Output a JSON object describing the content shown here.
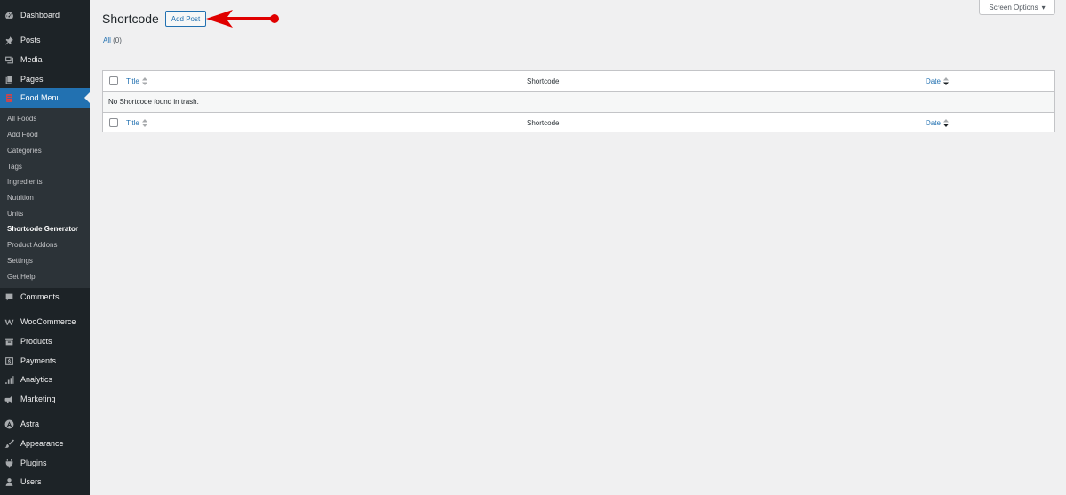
{
  "sidebar": {
    "items": [
      {
        "label": "Dashboard",
        "icon": "dashboard-icon"
      },
      {
        "label": "Posts",
        "icon": "pin-icon"
      },
      {
        "label": "Media",
        "icon": "media-icon"
      },
      {
        "label": "Pages",
        "icon": "pages-icon"
      },
      {
        "label": "Food Menu",
        "icon": "food-menu-icon"
      },
      {
        "label": "Comments",
        "icon": "comment-icon"
      },
      {
        "label": "WooCommerce",
        "icon": "woocommerce-icon"
      },
      {
        "label": "Products",
        "icon": "archive-icon"
      },
      {
        "label": "Payments",
        "icon": "dollar-icon"
      },
      {
        "label": "Analytics",
        "icon": "bar-chart-icon"
      },
      {
        "label": "Marketing",
        "icon": "megaphone-icon"
      },
      {
        "label": "Astra",
        "icon": "astra-icon"
      },
      {
        "label": "Appearance",
        "icon": "brush-icon"
      },
      {
        "label": "Plugins",
        "icon": "plugin-icon"
      },
      {
        "label": "Users",
        "icon": "user-icon"
      }
    ],
    "submenu": [
      "All Foods",
      "Add Food",
      "Categories",
      "Tags",
      "Ingredients",
      "Nutrition",
      "Units",
      "Shortcode Generator",
      "Product Addons",
      "Settings",
      "Get Help"
    ]
  },
  "header": {
    "title": "Shortcode",
    "add_button": "Add Post",
    "screen_options": "Screen Options"
  },
  "filters": {
    "all_label": "All",
    "all_count": "(0)"
  },
  "table": {
    "columns": [
      "Title",
      "Shortcode",
      "Date"
    ],
    "empty_message": "No Shortcode found in trash."
  },
  "colors": {
    "sidebar_bg": "#1d2327",
    "accent": "#2271b1",
    "annotation_arrow": "#e00000"
  }
}
